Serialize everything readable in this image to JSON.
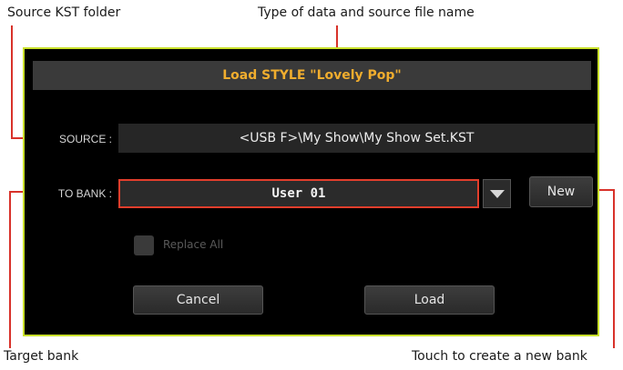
{
  "callouts": {
    "source_folder": "Source KST folder",
    "type_name": "Type of data and source file name",
    "target_bank": "Target bank",
    "new_bank": "Touch to create a new bank"
  },
  "dialog": {
    "title": "Load STYLE \"Lovely Pop\"",
    "source_label": "SOURCE :",
    "source_value": "<USB F>\\My Show\\My Show Set.KST",
    "to_bank_label": "TO BANK :",
    "to_bank_value": "User 01",
    "new_button": "New",
    "replace_all_label": "Replace All",
    "replace_all_checked": false,
    "cancel_button": "Cancel",
    "load_button": "Load"
  },
  "colors": {
    "dialog_border": "#c9e02a",
    "title_text": "#f0ad2e",
    "selected_border": "#e23e2c",
    "callout_line": "#d8322a"
  }
}
